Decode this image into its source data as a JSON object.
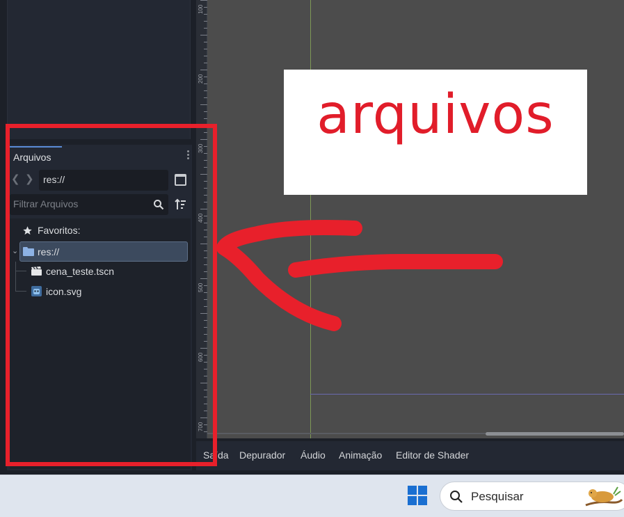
{
  "filesystem": {
    "tab_label": "Arquivos",
    "path_value": "res://",
    "filter_placeholder": "Filtrar Arquivos",
    "favorites_label": "Favoritos:",
    "root_label": "res://",
    "files": [
      {
        "name": "cena_teste.tscn",
        "icon": "scene-icon"
      },
      {
        "name": "icon.svg",
        "icon": "godot-icon"
      }
    ]
  },
  "ruler": {
    "labels": [
      "100",
      "200",
      "300",
      "400",
      "500",
      "600",
      "700"
    ]
  },
  "viewport": {
    "image_text": "arquivos"
  },
  "bottom_tabs": [
    "Saída",
    "Depurador",
    "Áudio",
    "Animação",
    "Editor de Shader"
  ],
  "taskbar": {
    "search_placeholder": "Pesquisar"
  },
  "colors": {
    "accent": "#5a8bd6",
    "selection": "#3c4a5e",
    "annotation_red": "#e8202b",
    "image_text_red": "#e11d2a"
  }
}
